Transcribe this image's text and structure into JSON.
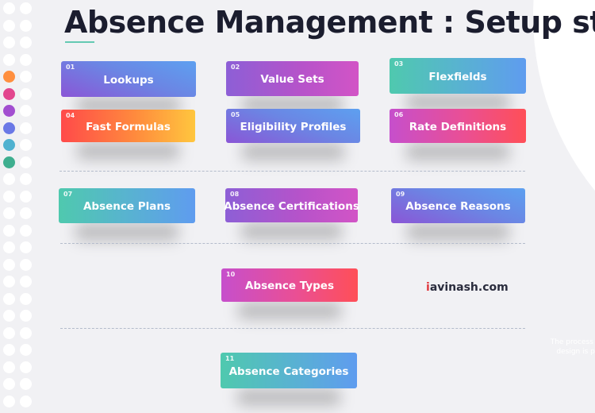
{
  "title": "Absence Management : Setup steps",
  "side_dots": {
    "accent_colors": [
      "#ff8f3f",
      "#e2468e",
      "#a24ed0",
      "#6a78e6",
      "#4fb1d0",
      "#3eae8f"
    ]
  },
  "steps": [
    {
      "num": "01",
      "label": "Lookups"
    },
    {
      "num": "02",
      "label": "Value Sets"
    },
    {
      "num": "03",
      "label": "Flexfields"
    },
    {
      "num": "04",
      "label": "Fast Formulas"
    },
    {
      "num": "05",
      "label": "Eligibility Profiles"
    },
    {
      "num": "06",
      "label": "Rate Definitions"
    },
    {
      "num": "07",
      "label": "Absence Plans"
    },
    {
      "num": "08",
      "label": "Absence Certifications"
    },
    {
      "num": "09",
      "label": "Absence Reasons"
    },
    {
      "num": "10",
      "label": "Absence Types"
    },
    {
      "num": "11",
      "label": "Absence Categories"
    }
  ],
  "brand": {
    "first_letter": "i",
    "rest": "avinash.com"
  },
  "faint_text": {
    "line1": "The process of lo",
    "line2": "design is part"
  }
}
